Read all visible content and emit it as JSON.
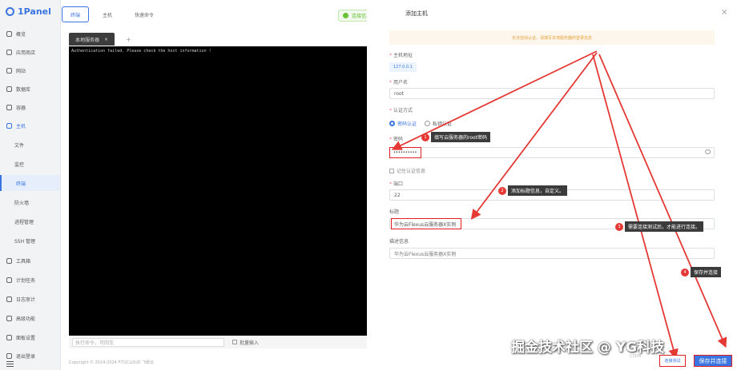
{
  "app": {
    "logo": "1Panel"
  },
  "sidebar": {
    "items": [
      {
        "label": "概览"
      },
      {
        "label": "应用商店"
      },
      {
        "label": "网站"
      },
      {
        "label": "数据库"
      },
      {
        "label": "容器"
      },
      {
        "label": "主机"
      },
      {
        "label": "文件"
      },
      {
        "label": "监控"
      },
      {
        "label": "终端"
      },
      {
        "label": "防火墙"
      },
      {
        "label": "进程管理"
      },
      {
        "label": "SSH 管理"
      },
      {
        "label": "工具箱"
      },
      {
        "label": "计划任务"
      },
      {
        "label": "日志审计"
      },
      {
        "label": "高级功能"
      },
      {
        "label": "面板设置"
      },
      {
        "label": "退出登录"
      }
    ]
  },
  "topbar": {
    "tabs": [
      {
        "label": "终端"
      },
      {
        "label": "主机"
      },
      {
        "label": "快速命令"
      }
    ]
  },
  "terminal": {
    "tab_label": "本地服务器",
    "tab_close": "×",
    "add_tab": "+",
    "output": "Authentication failed.  Please check the host information !"
  },
  "cmdbar": {
    "placeholder": "执行命令，可回车",
    "batch_label": "批量输入"
  },
  "footer": {
    "text": "Copyright © 2014-2024 FIT2CLOUD 飞致云"
  },
  "toast": {
    "text": "连接信息可用",
    "close": "×"
  },
  "drawer": {
    "title": "添加主机",
    "close": "×",
    "warning": "无法自动认证，请填写本地服务器的登录信息",
    "fields": {
      "addr_label": "主机地址",
      "addr_value": "127.0.0.1",
      "user_label": "用户名",
      "user_value": "root",
      "auth_label": "认证方式",
      "auth_options": [
        "密码认证",
        "私钥认证"
      ],
      "pw_label": "密码",
      "pw_value": "••••••••••",
      "remember_label": "记住认证信息",
      "port_label": "端口",
      "port_value": "22",
      "title_label": "标题",
      "title_value": "华为云Flexus云服务器X实例",
      "desc_label": "描述信息",
      "desc_value": "华为云Flexus云服务器X实例"
    },
    "buttons": {
      "test": "连接测试",
      "save": "保存并连接"
    }
  },
  "annotations": [
    {
      "num": "1",
      "text": "填写云服务器的root密码"
    },
    {
      "num": "2",
      "text": "添加标题信息，自定义。"
    },
    {
      "num": "3",
      "text": "需要连接测试后，才能进行连接。"
    },
    {
      "num": "4",
      "text": "保存并连接"
    }
  ],
  "watermark": {
    "text": "掘金技术社区 @ YG科技",
    "sub": "CSDN"
  },
  "colors": {
    "accent": "#3a74e0",
    "annotation": "#e53935",
    "warning_bg": "#fdf6ec",
    "success": "#67c23a"
  }
}
